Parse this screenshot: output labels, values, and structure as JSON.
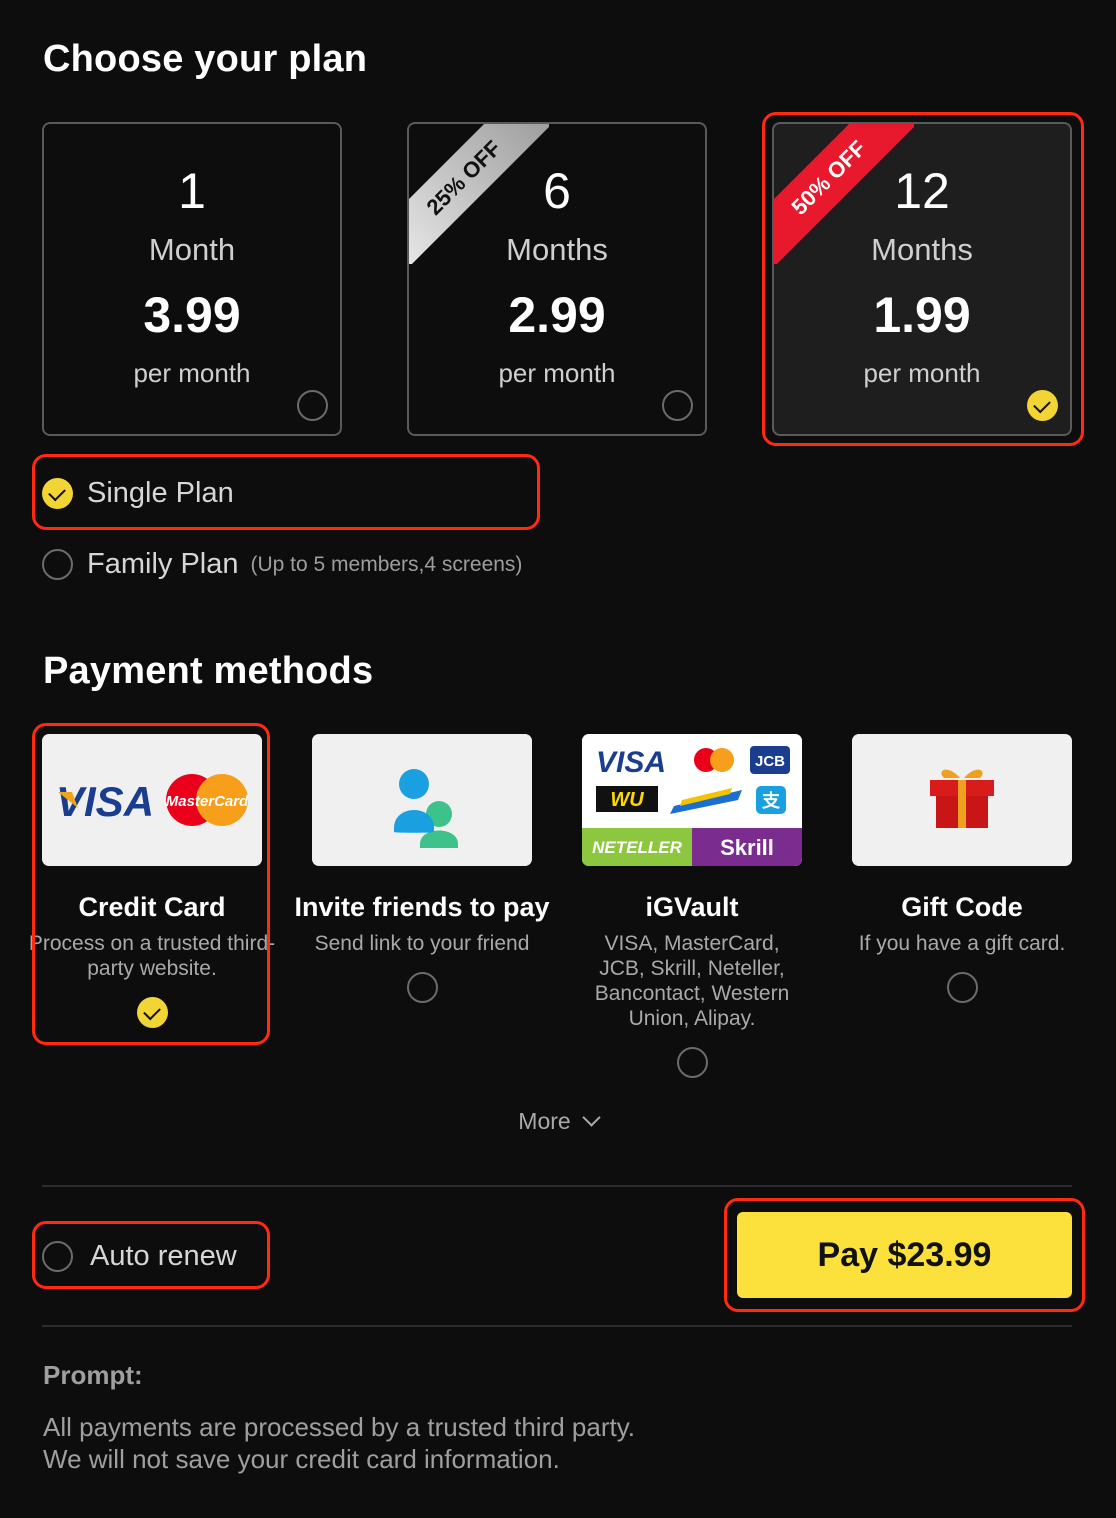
{
  "plan_section": {
    "title": "Choose your plan"
  },
  "plans": [
    {
      "count": "1",
      "unit": "Month",
      "price": "3.99",
      "per": "per month",
      "badge": "",
      "selected": false
    },
    {
      "count": "6",
      "unit": "Months",
      "price": "2.99",
      "per": "per month",
      "badge": "25% OFF",
      "selected": false
    },
    {
      "count": "12",
      "unit": "Months",
      "price": "1.99",
      "per": "per month",
      "badge": "50% OFF",
      "selected": true
    }
  ],
  "plan_types": {
    "single": {
      "label": "Single Plan",
      "selected": true
    },
    "family": {
      "label": "Family Plan",
      "note": "(Up to 5 members,4 screens)",
      "selected": false
    }
  },
  "payment_section": {
    "title": "Payment methods"
  },
  "payment_methods": [
    {
      "title": "Credit Card",
      "desc": "Process on a trusted third-party website.",
      "selected": true,
      "logo_text": [
        "VISA",
        "MasterCard"
      ]
    },
    {
      "title": "Invite friends to pay",
      "desc": "Send link to your friend",
      "selected": false,
      "icon": "users-icon"
    },
    {
      "title": "iGVault",
      "desc": "VISA, MasterCard, JCB, Skrill, Neteller, Bancontact, Western Union, Alipay.",
      "selected": false,
      "logo_text": [
        "VISA",
        "JCB",
        "WU",
        "支",
        "NETELLER",
        "Skrill"
      ]
    },
    {
      "title": "Gift Code",
      "desc": "If you have a gift card.",
      "selected": false,
      "icon": "gift-icon"
    }
  ],
  "more_label": "More",
  "auto_renew": {
    "label": "Auto renew",
    "checked": false
  },
  "pay_button": {
    "label": "Pay $23.99"
  },
  "prompt": {
    "title": "Prompt:",
    "line1": "All payments are processed by a trusted third party.",
    "line2": "We will not save your credit card information."
  },
  "colors": {
    "accent": "#fce03b",
    "highlight": "#ff2a10",
    "badge_red": "#e8192c"
  }
}
